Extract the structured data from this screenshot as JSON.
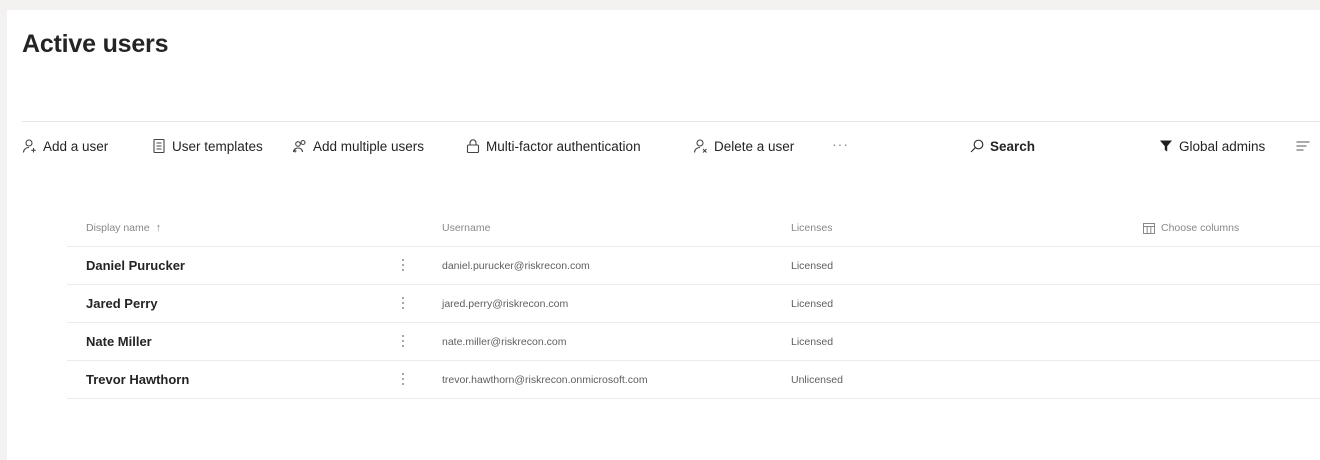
{
  "page": {
    "title": "Active users"
  },
  "toolbar": {
    "add_user": "Add a user",
    "user_templates": "User templates",
    "add_multiple_users": "Add multiple users",
    "mfa": "Multi-factor authentication",
    "delete_user": "Delete a user",
    "more": "···",
    "search": "Search",
    "filter": "Global admins"
  },
  "table": {
    "columns": {
      "display_name": "Display name",
      "sort_indicator": "↑",
      "username": "Username",
      "licenses": "Licenses",
      "choose_columns": "Choose columns"
    },
    "rows": [
      {
        "name": "Daniel Purucker",
        "username": "daniel.purucker@riskrecon.com",
        "license": "Licensed"
      },
      {
        "name": "Jared Perry",
        "username": "jared.perry@riskrecon.com",
        "license": "Licensed"
      },
      {
        "name": "Nate Miller",
        "username": "nate.miller@riskrecon.com",
        "license": "Licensed"
      },
      {
        "name": "Trevor Hawthorn",
        "username": "trevor.hawthorn@riskrecon.onmicrosoft.com",
        "license": "Unlicensed"
      }
    ]
  },
  "colors": {
    "text_primary": "#242424",
    "text_secondary": "#605e5c",
    "muted": "#8a8886",
    "background": "#f3f2f1",
    "surface": "#ffffff"
  },
  "icons": {
    "add_user": "person-add-icon",
    "user_templates": "template-icon",
    "add_multiple_users": "people-add-icon",
    "mfa": "lock-icon",
    "delete_user": "person-delete-icon",
    "search": "search-icon",
    "filter": "filter-icon",
    "view": "view-options-icon",
    "choose_columns": "columns-icon",
    "row_actions": "more-vertical-icon"
  }
}
